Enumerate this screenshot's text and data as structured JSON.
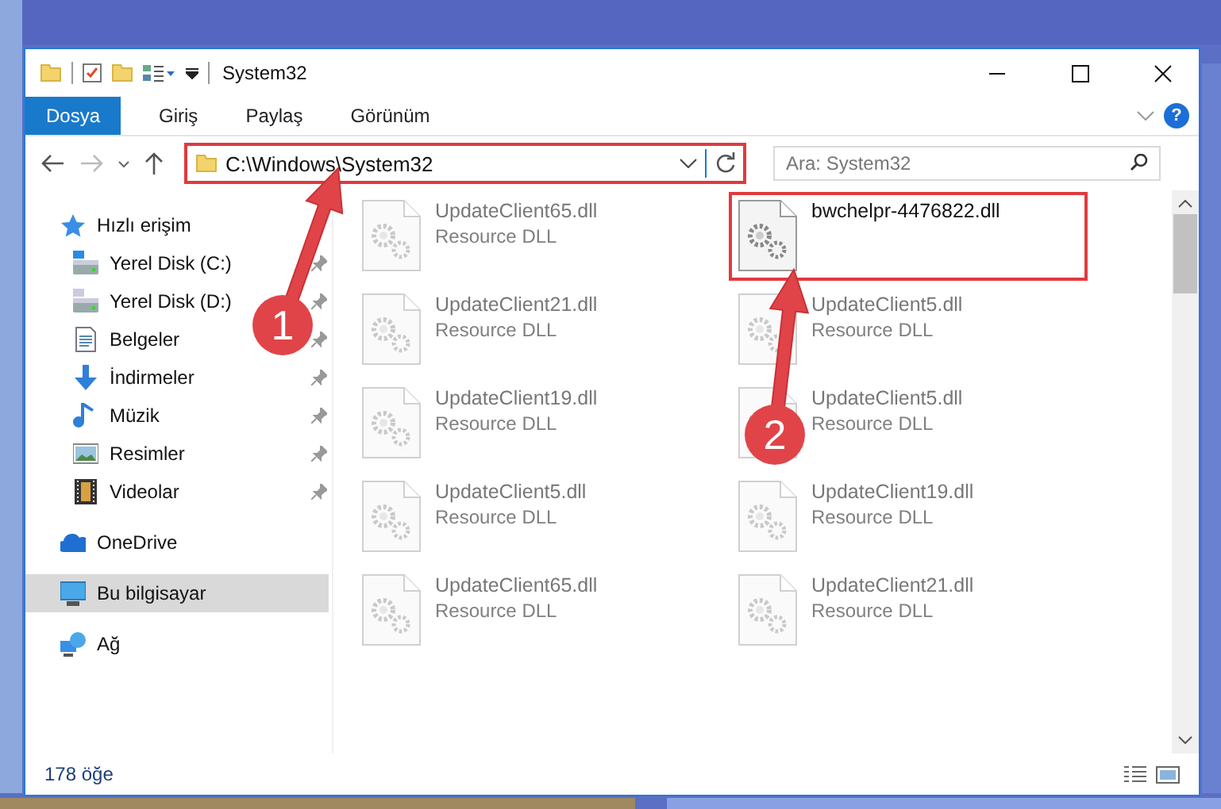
{
  "window": {
    "title": "System32"
  },
  "ribbon": {
    "tabs": [
      {
        "label": "Dosya",
        "kind": "file",
        "selected": false
      },
      {
        "label": "Giriş",
        "kind": "tab",
        "selected": false
      },
      {
        "label": "Paylaş",
        "kind": "tab",
        "selected": false
      },
      {
        "label": "Görünüm",
        "kind": "tab",
        "selected": false
      }
    ],
    "help": "?"
  },
  "address_bar": {
    "path": "C:\\Windows\\System32",
    "highlighted": true
  },
  "search": {
    "placeholder": "Ara: System32"
  },
  "sidebar": {
    "items": [
      {
        "label": "Hızlı erişim",
        "selected": false,
        "children": [
          {
            "label": "Yerel Disk (C:)",
            "pinned": true,
            "selected": false
          },
          {
            "label": "Yerel Disk (D:)",
            "pinned": true,
            "selected": false
          },
          {
            "label": "Belgeler",
            "pinned": true,
            "selected": false
          },
          {
            "label": "İndirmeler",
            "pinned": true,
            "selected": false
          },
          {
            "label": "Müzik",
            "pinned": true,
            "selected": false
          },
          {
            "label": "Resimler",
            "pinned": true,
            "selected": false
          },
          {
            "label": "Videolar",
            "pinned": true,
            "selected": false
          }
        ]
      },
      {
        "label": "OneDrive",
        "selected": false
      },
      {
        "label": "Bu bilgisayar",
        "selected": true
      },
      {
        "label": "Ağ",
        "selected": false
      }
    ]
  },
  "files": [
    {
      "name": "UpdateClient65.dll",
      "type": "Resource DLL",
      "highlighted": false
    },
    {
      "name": "bwchelpr-4476822.dll",
      "highlighted": true
    },
    {
      "name": "UpdateClient21.dll",
      "type": "Resource DLL",
      "highlighted": false
    },
    {
      "name": "UpdateClient5.dll",
      "type": "Resource DLL",
      "highlighted": false
    },
    {
      "name": "UpdateClient19.dll",
      "type": "Resource DLL",
      "highlighted": false
    },
    {
      "name": "UpdateClient5.dll",
      "type": "Resource DLL",
      "highlighted": false
    },
    {
      "name": "UpdateClient5.dll",
      "type": "Resource DLL",
      "highlighted": false
    },
    {
      "name": "UpdateClient19.dll",
      "type": "Resource DLL",
      "highlighted": false
    },
    {
      "name": "UpdateClient65.dll",
      "type": "Resource DLL",
      "highlighted": false
    },
    {
      "name": "UpdateClient21.dll",
      "type": "Resource DLL",
      "highlighted": false
    }
  ],
  "status_bar": {
    "count": "178 öğe"
  },
  "callouts": [
    {
      "number": "1"
    },
    {
      "number": "2"
    }
  ]
}
